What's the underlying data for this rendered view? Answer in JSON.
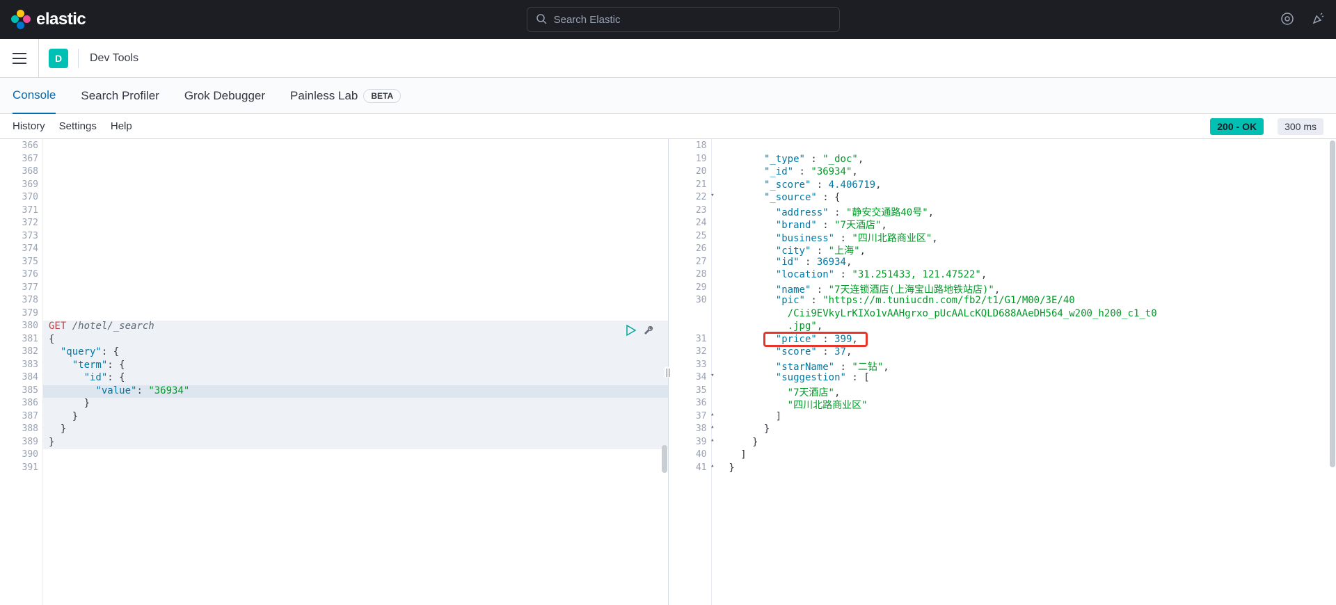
{
  "brand": "elastic",
  "search": {
    "placeholder": "Search Elastic"
  },
  "space_letter": "D",
  "page_title": "Dev Tools",
  "tabs": {
    "console": "Console",
    "profiler": "Search Profiler",
    "grok": "Grok Debugger",
    "painless": "Painless Lab",
    "beta": "BETA"
  },
  "toolbar": {
    "history": "History",
    "settings": "Settings",
    "help": "Help",
    "status": "200 - OK",
    "time": "300 ms"
  },
  "leftPane": {
    "startLine": 366,
    "method": "GET",
    "path": "/hotel/_search",
    "search_value": "36934",
    "lines": {
      "l380": "GET /hotel/_search",
      "l381": "{",
      "l382": "  \"query\": {",
      "l383": "    \"term\": {",
      "l384": "      \"id\": {",
      "l385": "        \"value\": \"36934\"",
      "l386": "      }",
      "l387": "    }",
      "l388": "  }",
      "l389": "}"
    }
  },
  "rightPane": {
    "lines": {
      "l19_k": "\"_type\"",
      "l19_v": "\"_doc\"",
      "l20_k": "\"_id\"",
      "l20_v": "\"36934\"",
      "l21_k": "\"_score\"",
      "l21_v": "4.406719",
      "l22_k": "\"_source\"",
      "l23_k": "\"address\"",
      "l23_v": "\"静安交通路40号\"",
      "l24_k": "\"brand\"",
      "l24_v": "\"7天酒店\"",
      "l25_k": "\"business\"",
      "l25_v": "\"四川北路商业区\"",
      "l26_k": "\"city\"",
      "l26_v": "\"上海\"",
      "l27_k": "\"id\"",
      "l27_v": "36934",
      "l28_k": "\"location\"",
      "l28_v": "\"31.251433, 121.47522\"",
      "l29_k": "\"name\"",
      "l29_v": "\"7天连锁酒店(上海宝山路地铁站店)\"",
      "l30_k": "\"pic\"",
      "l30_v1": "\"https://m.tuniucdn.com/fb2/t1/G1/M00/3E/40",
      "l30_v2": "/Cii9EVkyLrKIXo1vAAHgrxo_pUcAALcKQLD688AAeDH564_w200_h200_c1_t0",
      "l30_v3": ".jpg\"",
      "l31_k": "\"price\"",
      "l31_v": "399",
      "l32_k": "\"score\"",
      "l32_v": "37",
      "l33_k": "\"starName\"",
      "l33_v": "\"二钻\"",
      "l34_k": "\"suggestion\"",
      "l35_v": "\"7天酒店\"",
      "l36_v": "\"四川北路商业区\""
    }
  }
}
